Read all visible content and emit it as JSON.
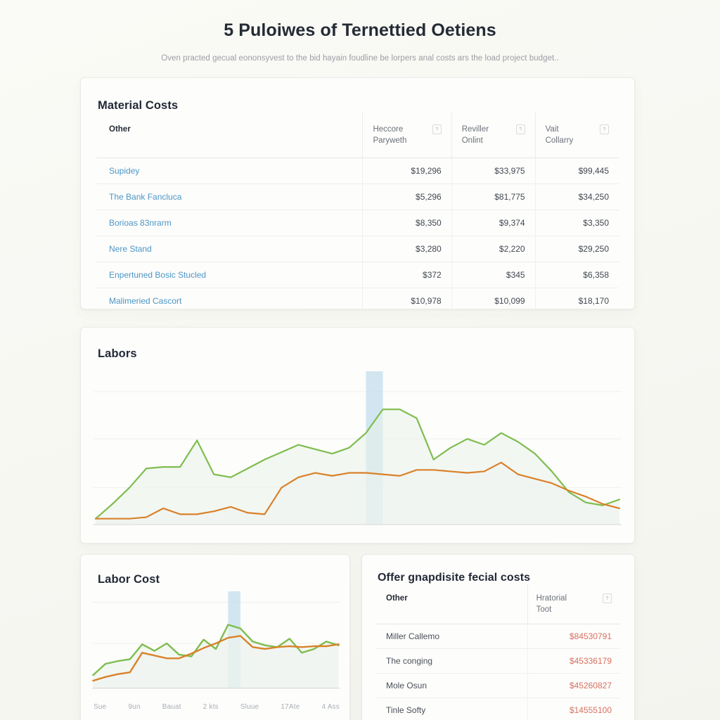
{
  "hero": {
    "title": "5 Puloiwes of Ternettied Oetiens",
    "subtitle": "Oven practed gecual eononsyvest to the bid hayain foudline be lorpers anal costs ars the load project budget.."
  },
  "material_costs": {
    "title": "Material Costs",
    "columns": [
      {
        "label": "Other",
        "icon": null
      },
      {
        "label": "Heccore\nParyweth",
        "icon": "info-icon"
      },
      {
        "label": "Reviller\nOnlint",
        "icon": "info-icon"
      },
      {
        "label": "Vait\nCollarry",
        "icon": "info-icon"
      }
    ],
    "rows": [
      {
        "name": "Supidey",
        "c1": "$19,296",
        "c2": "$33,975",
        "c3": "$99,445"
      },
      {
        "name": "The Bank Fancluca",
        "c1": "$5,296",
        "c2": "$81,775",
        "c3": "$34,250"
      },
      {
        "name": "Borioas 83nrarm",
        "c1": "$8,350",
        "c2": "$9,374",
        "c3": "$3,350"
      },
      {
        "name": "Nere Stand",
        "c1": "$3,280",
        "c2": "$2,220",
        "c3": "$29,250"
      },
      {
        "name": "Enpertuned Bosic Stucled",
        "c1": "$372",
        "c2": "$345",
        "c3": "$6,358"
      },
      {
        "name": "Malimeried Cascort",
        "c1": "$10,978",
        "c2": "$10,099",
        "c3": "$18,170"
      }
    ]
  },
  "labors": {
    "title": "Labors"
  },
  "labor_cost": {
    "title": "Labor Cost",
    "xticks": [
      "Sue",
      "9un",
      "Bauat",
      "2 kts",
      "Sluue",
      "17Ate",
      "4 Ass"
    ]
  },
  "offer": {
    "title": "Offer gnapdisite fecial costs",
    "columns": [
      {
        "label": "Other",
        "icon": null
      },
      {
        "label": "Hratorial\nToot",
        "icon": "info-icon"
      }
    ],
    "rows": [
      {
        "name": "Miller Callemo",
        "value": "$84530791"
      },
      {
        "name": "The conging",
        "value": "$45336179"
      },
      {
        "name": "Mole Osun",
        "value": "$45260827"
      },
      {
        "name": "Tinle Softy",
        "value": "$14555100"
      }
    ]
  },
  "colors": {
    "green": "#7fbd4f",
    "orange": "#d9812a",
    "highlight": "#bfdcec",
    "link": "#4c96c4",
    "danger": "#d9705e",
    "background": "#f8f8f4"
  },
  "chart_data": [
    {
      "type": "line",
      "title": "Labors",
      "id": "labors-chart",
      "xlabel": "",
      "ylabel": "",
      "grid": true,
      "legend": "none",
      "ylim": [
        0,
        100
      ],
      "highlight_band": {
        "from_index": 16,
        "to_index": 17
      },
      "x": [
        0,
        1,
        2,
        3,
        4,
        5,
        6,
        7,
        8,
        9,
        10,
        11,
        12,
        13,
        14,
        15,
        16,
        17,
        18,
        19,
        20,
        21,
        22,
        23,
        24,
        25,
        26,
        27,
        28,
        29,
        30,
        31
      ],
      "series": [
        {
          "name": "green",
          "color": "#7fbd4f",
          "values": [
            4,
            14,
            25,
            38,
            39,
            39,
            57,
            34,
            32,
            38,
            44,
            49,
            54,
            51,
            48,
            52,
            62,
            78,
            78,
            72,
            44,
            52,
            58,
            54,
            62,
            56,
            48,
            36,
            22,
            15,
            13,
            17
          ]
        },
        {
          "name": "orange",
          "color": "#d9812a",
          "values": [
            4,
            4,
            4,
            5,
            11,
            7,
            7,
            9,
            12,
            8,
            7,
            25,
            32,
            35,
            33,
            35,
            35,
            34,
            33,
            37,
            37,
            36,
            35,
            36,
            42,
            34,
            31,
            28,
            23,
            19,
            14,
            11
          ]
        }
      ]
    },
    {
      "type": "line",
      "title": "Labor Cost",
      "id": "labor-cost-chart",
      "xlabel": "",
      "ylabel": "",
      "grid": true,
      "legend": "none",
      "ylim": [
        0,
        100
      ],
      "highlight_band": {
        "from_index": 11,
        "to_index": 12
      },
      "x": [
        0,
        1,
        2,
        3,
        4,
        5,
        6,
        7,
        8,
        9,
        10,
        11,
        12,
        13,
        14,
        15,
        16,
        17,
        18,
        19,
        20
      ],
      "series": [
        {
          "name": "green",
          "color": "#7fbd4f",
          "values": [
            14,
            26,
            29,
            31,
            47,
            40,
            48,
            36,
            34,
            52,
            42,
            68,
            64,
            50,
            46,
            44,
            53,
            38,
            42,
            50,
            46
          ]
        },
        {
          "name": "orange",
          "color": "#d9812a",
          "values": [
            8,
            12,
            15,
            17,
            38,
            35,
            32,
            32,
            37,
            43,
            48,
            54,
            56,
            44,
            42,
            44,
            45,
            44,
            45,
            45,
            47
          ]
        }
      ]
    }
  ]
}
